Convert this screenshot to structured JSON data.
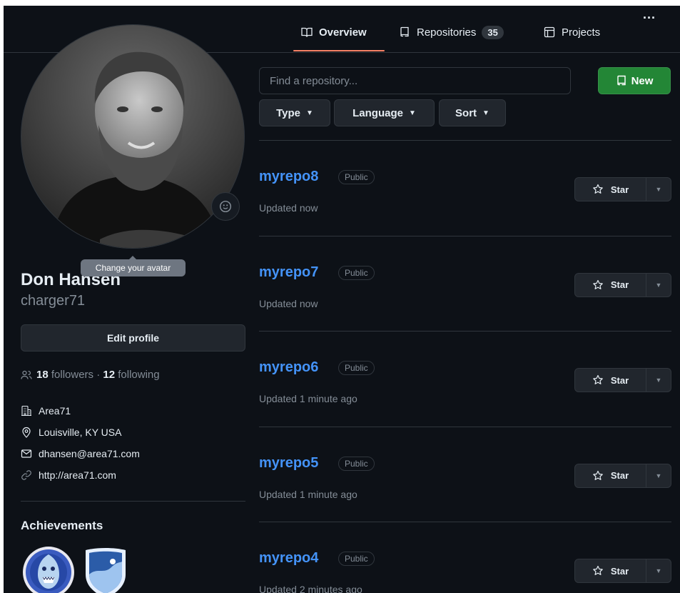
{
  "nav": {
    "tabs": [
      {
        "label": "Overview",
        "icon": "book-icon"
      },
      {
        "label": "Repositories",
        "icon": "repo-icon",
        "count": "35"
      },
      {
        "label": "Projects",
        "icon": "table-icon"
      }
    ],
    "more": "..."
  },
  "profile": {
    "tooltip": "Change your avatar",
    "name": "Don Hansen",
    "login": "charger71",
    "edit_label": "Edit profile",
    "followers_count": "18",
    "followers_label": "followers",
    "dot": "·",
    "following_count": "12",
    "following_label": "following",
    "details": [
      {
        "icon": "organization-icon",
        "text": "Area71"
      },
      {
        "icon": "location-icon",
        "text": "Louisville, KY USA"
      },
      {
        "icon": "mail-icon",
        "text": "dhansen@area71.com"
      },
      {
        "icon": "link-icon",
        "text": "http://area71.com"
      }
    ],
    "achievements_title": "Achievements"
  },
  "repos_toolbar": {
    "search_placeholder": "Find a repository...",
    "new_label": "New",
    "filters": [
      "Type",
      "Language",
      "Sort"
    ]
  },
  "repos": [
    {
      "name": "myrepo8",
      "visibility": "Public",
      "updated": "Updated now",
      "star_label": "Star"
    },
    {
      "name": "myrepo7",
      "visibility": "Public",
      "updated": "Updated now",
      "star_label": "Star"
    },
    {
      "name": "myrepo6",
      "visibility": "Public",
      "updated": "Updated 1 minute ago",
      "star_label": "Star"
    },
    {
      "name": "myrepo5",
      "visibility": "Public",
      "updated": "Updated 1 minute ago",
      "star_label": "Star"
    },
    {
      "name": "myrepo4",
      "visibility": "Public",
      "updated": "Updated 2 minutes ago",
      "star_label": "Star"
    }
  ],
  "colors": {
    "background": "#0d1117",
    "accent_link": "#4493f8",
    "new_button": "#238636",
    "tab_underline": "#f78166"
  }
}
